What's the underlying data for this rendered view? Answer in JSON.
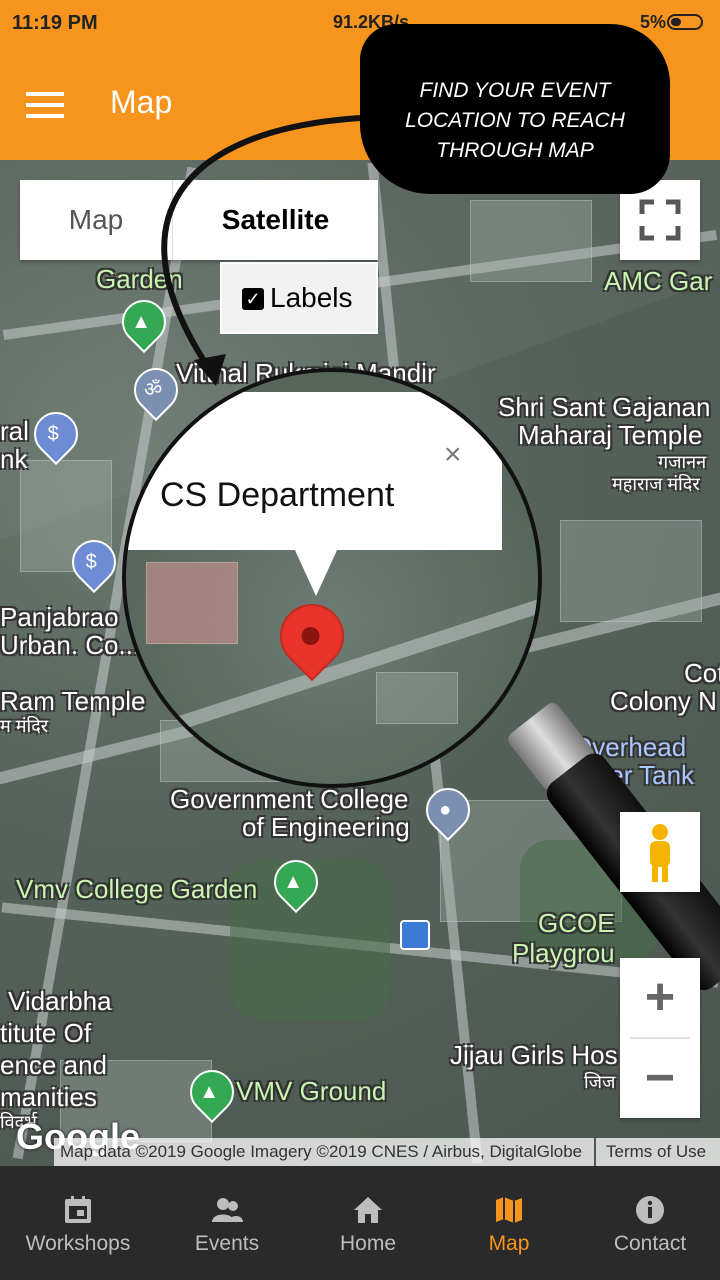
{
  "status_bar": {
    "time": "11:19 PM",
    "network_speed": "91.2KB/s",
    "battery_percent": "5%"
  },
  "app_bar": {
    "title": "Map",
    "menu_icon": "hamburger-menu-icon"
  },
  "annotation": {
    "line1": "FIND YOUR EVENT",
    "line2": "LOCATION TO REACH THROUGH MAP"
  },
  "map_controls": {
    "map_label": "Map",
    "satellite_label": "Satellite",
    "labels_checkbox": "Labels",
    "labels_checked": true,
    "zoom_in": "+",
    "zoom_out": "−"
  },
  "map_labels": {
    "shri_sant": "Shri Sant Gajanan",
    "maharaj_temple": "Maharaj Temple",
    "gajanan_hi": "गजानन",
    "maharaj_hi": "महाराज मंदिर",
    "vitthal": "Vitthal Rukmini Mandir",
    "garden": "Garden",
    "amc": "AMC Gar",
    "panjabrao": "Panjabrao",
    "urban": "Urban. Co...",
    "ram_temple": "Ram Temple",
    "ram_hi": "म मंदिर",
    "rural": "ral",
    "bank": "nk",
    "gov_college1": "Government College",
    "gov_college2": "of Engineering",
    "overhead1": "Overhead",
    "overhead2": "Water Tank",
    "cot": "Cot",
    "colony": "Colony N",
    "vmv_garden": "Vmv College Garden",
    "gcoe": "GCOE",
    "playground": "Playgrou",
    "vidarbha1": "Vidarbha",
    "vidarbha2": "titute Of",
    "vidarbha3": "ence and",
    "vidarbha4": "manities",
    "vidarbha_hi": "विदर्भ",
    "jijau": "Jijau Girls Hos",
    "jijau_hi": "जिज",
    "vmv_ground": "VMV Ground"
  },
  "info_window": {
    "title": "CS Department",
    "close": "×"
  },
  "attribution": {
    "google": "Google",
    "map_data": "Map data ©2019 Google Imagery ©2019 CNES / Airbus, DigitalGlobe",
    "terms": "Terms of Use"
  },
  "bottom_nav": [
    {
      "label": "Workshops",
      "icon": "calendar-icon",
      "active": false
    },
    {
      "label": "Events",
      "icon": "people-icon",
      "active": false
    },
    {
      "label": "Home",
      "icon": "home-icon",
      "active": false
    },
    {
      "label": "Map",
      "icon": "map-icon",
      "active": true
    },
    {
      "label": "Contact",
      "icon": "info-icon",
      "active": false
    }
  ],
  "colors": {
    "accent": "#f7941d",
    "nav_bg": "#2a2a2a",
    "pin": "#e8332a"
  }
}
